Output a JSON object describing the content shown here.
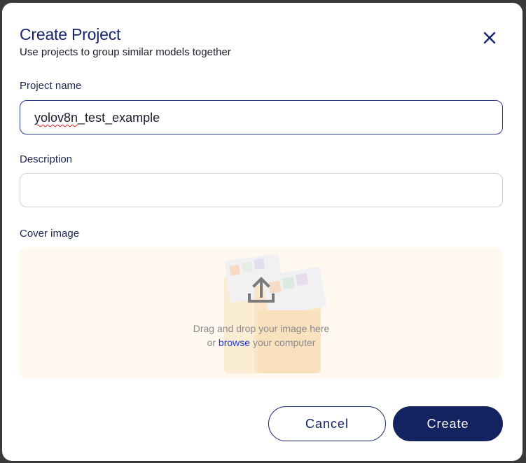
{
  "modal": {
    "title": "Create Project",
    "subtitle": "Use projects to group similar models together",
    "close_icon": "close-icon"
  },
  "form": {
    "project_name": {
      "label": "Project name",
      "value_misspelled": "yolov8n",
      "value_rest": "_test_example"
    },
    "description": {
      "label": "Description",
      "value": "",
      "placeholder": ""
    },
    "cover_image": {
      "label": "Cover image",
      "drop_text": "Drag and drop your image here",
      "or_text": "or",
      "browse_text": "browse",
      "computer_text": "your computer",
      "icon": "upload-icon"
    }
  },
  "actions": {
    "cancel_label": "Cancel",
    "create_label": "Create"
  },
  "colors": {
    "primary": "#13235f",
    "title": "#13246b",
    "link": "#1d3fcf",
    "dropzone_bg": "#fff8ef"
  }
}
